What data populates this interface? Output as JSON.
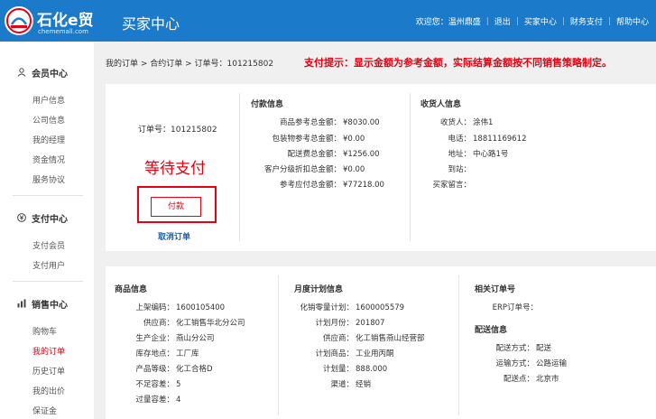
{
  "header": {
    "brand": "石化e贸",
    "url": "chememall.com",
    "title": "买家中心",
    "nav": {
      "welcome": "欢迎您：温州鼎盛",
      "logout": "退出",
      "buyer_center": "买家中心",
      "finance": "财务支付",
      "help": "帮助中心"
    }
  },
  "sidebar": {
    "groups": [
      {
        "title": "会员中心",
        "icon": "user-icon",
        "items": [
          "用户信息",
          "公司信息",
          "我的经理",
          "资金情况",
          "服务协议"
        ]
      },
      {
        "title": "支付中心",
        "icon": "yen-icon",
        "items": [
          "支付会员",
          "支付用户"
        ]
      },
      {
        "title": "销售中心",
        "icon": "chart-icon",
        "items": [
          "购物车",
          "我的订单",
          "历史订单",
          "我的出价",
          "保证金"
        ]
      }
    ],
    "active_item": "我的订单"
  },
  "breadcrumb": "我的订单 > 合约订单 > 订单号：101215802",
  "tip": "支付提示：显示金额为参考金额，实际结算金额按不同销售策略制定。",
  "order": {
    "number_label": "订单号：",
    "number": "101215802",
    "status": "等待支付",
    "pay_button": "付款",
    "cancel": "取消订单"
  },
  "payment": {
    "title": "付款信息",
    "rows": [
      {
        "label": "商品参考总金额：",
        "value": "¥8030.00"
      },
      {
        "label": "包装物参考总金额：",
        "value": "¥0.00"
      },
      {
        "label": "配送费总金额：",
        "value": "¥1256.00"
      },
      {
        "label": "客户分级折扣总金额：",
        "value": "¥0.00"
      },
      {
        "label": "参考应付总金额：",
        "value": "¥77218.00"
      }
    ]
  },
  "consignee": {
    "title": "收货人信息",
    "rows": [
      {
        "label": "收货人：",
        "value": "涂伟1"
      },
      {
        "label": "电话：",
        "value": "18811169612"
      },
      {
        "label": "地址：",
        "value": "中心路1号"
      },
      {
        "label": "到站：",
        "value": ""
      },
      {
        "label": "买家留言：",
        "value": ""
      }
    ]
  },
  "goods": {
    "title": "商品信息",
    "rows": [
      {
        "label": "上架编码：",
        "value": "1600105400"
      },
      {
        "label": "供应商：",
        "value": "化工销售华北分公司"
      },
      {
        "label": "生产企业：",
        "value": "燕山分公司"
      },
      {
        "label": "库存地点：",
        "value": "工厂库"
      },
      {
        "label": "产品等级：",
        "value": "化工合格D"
      },
      {
        "label": "不足容差：",
        "value": "5"
      },
      {
        "label": "过量容差：",
        "value": "4"
      }
    ]
  },
  "plan": {
    "title": "月度计划信息",
    "rows": [
      {
        "label": "化销零量计划：",
        "value": "1600005579"
      },
      {
        "label": "计划月份：",
        "value": "201807"
      },
      {
        "label": "供应商：",
        "value": "化工销售燕山经营部"
      },
      {
        "label": "计划商品：",
        "value": "工业用丙酮"
      },
      {
        "label": "计划量：",
        "value": "888.000"
      },
      {
        "label": "渠道：",
        "value": "经销"
      }
    ]
  },
  "related": {
    "title": "相关订单号",
    "rows": [
      {
        "label": "ERP订单号：",
        "value": ""
      }
    ]
  },
  "delivery": {
    "title": "配送信息",
    "rows": [
      {
        "label": "配送方式：",
        "value": "配送"
      },
      {
        "label": "运输方式：",
        "value": "公路运输"
      },
      {
        "label": "配送点：",
        "value": "北京市"
      }
    ]
  },
  "colors": {
    "header_blue": "#1b7ac9",
    "alert_red": "#e60012",
    "link_blue": "#1b5fa8"
  }
}
